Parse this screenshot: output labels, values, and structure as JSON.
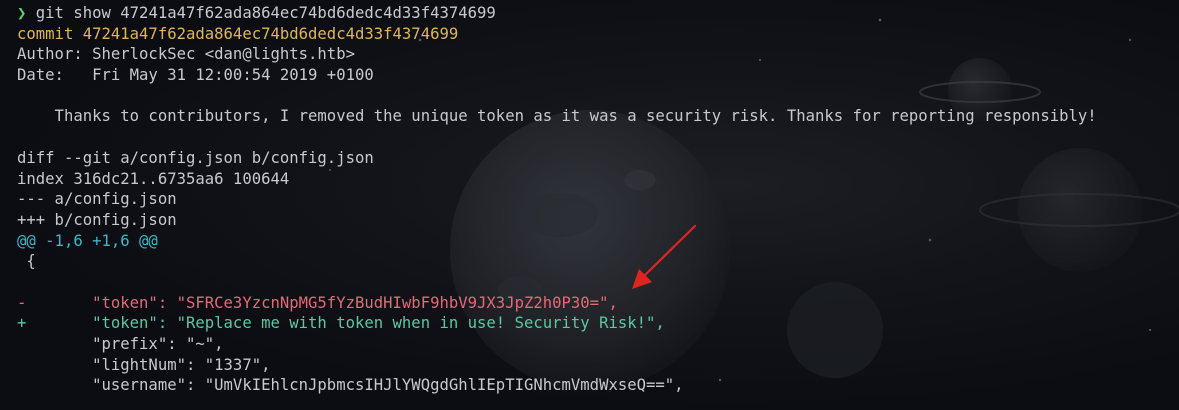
{
  "prompt": {
    "symbol": "❯",
    "command": " git show 47241a47f62ada864ec74bd6dedc4d33f4374699"
  },
  "commit": {
    "line": "commit 47241a47f62ada864ec74bd6dedc4d33f4374699",
    "author": "Author: SherlockSec <dan@lights.htb>",
    "date": "Date:   Fri May 31 12:00:54 2019 +0100",
    "message": "    Thanks to contributors, I removed the unique token as it was a security risk. Thanks for reporting responsibly!"
  },
  "diff": {
    "header": "diff --git a/config.json b/config.json",
    "index": "index 316dc21..6735aa6 100644",
    "old_file": "--- a/config.json",
    "new_file": "+++ b/config.json",
    "hunk": "@@ -1,6 +1,6 @@",
    "open_brace": " {",
    "removed": "-       \"token\": \"SFRCe3YzcnNpMG5fYzBudHIwbF9hbV9JX3JpZ2h0P30=\",",
    "added": "+       \"token\": \"Replace me with token when in use! Security Risk!\",",
    "context": [
      "        \"prefix\": \"~\",",
      "        \"lightNum\": \"1337\",",
      "        \"username\": \"UmVkIEhlcnJpbmcsIHJlYWQgdGhlIEpTIGNhcmVmdWxseQ==\","
    ]
  },
  "colors": {
    "background": "#0b0d13",
    "prompt_arrow": "#5fd068",
    "commit_hash": "#e0b55a",
    "removed_line": "#e26b76",
    "added_line": "#5cc8a0",
    "hunk_header": "#39b8c6",
    "annotation_arrow": "#e0251f"
  },
  "annotation": {
    "icon": "red-arrow-icon"
  }
}
